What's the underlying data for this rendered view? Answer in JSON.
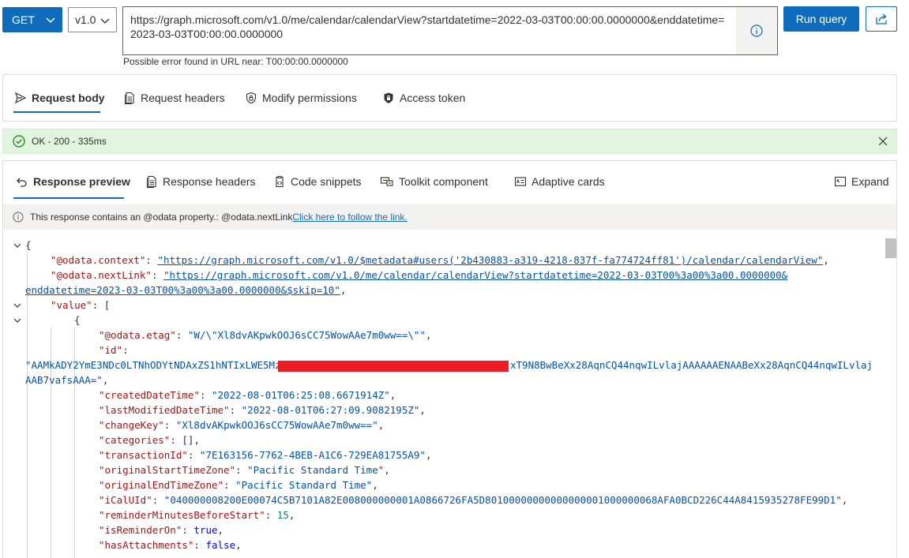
{
  "toolbar": {
    "method": "GET",
    "version": "v1.0",
    "url": "https://graph.microsoft.com/v1.0/me/calendar/calendarView?startdatetime=2022-03-03T00:00:00.0000000&enddatetime=2023-03-03T00:00:00.0000000",
    "url_error": "Possible error found in URL near: T00:00:00.0000000",
    "run_label": "Run query"
  },
  "request_tabs": [
    {
      "label": "Request body",
      "icon": "send-icon"
    },
    {
      "label": "Request headers",
      "icon": "document-icon"
    },
    {
      "label": "Modify permissions",
      "icon": "shield-lock-icon"
    },
    {
      "label": "Access token",
      "icon": "lock-icon"
    }
  ],
  "status": {
    "text": "OK - 200 - 335ms",
    "color": "#dff6dd"
  },
  "response_tabs": [
    {
      "label": "Response preview",
      "icon": "undo-arrow-icon"
    },
    {
      "label": "Response headers",
      "icon": "document-icon"
    },
    {
      "label": "Code snippets",
      "icon": "clipboard-code-icon"
    },
    {
      "label": "Toolkit component",
      "icon": "component-icon"
    },
    {
      "label": "Adaptive cards",
      "icon": "card-icon"
    }
  ],
  "expand_label": "Expand",
  "info": {
    "text": "This response contains an @odata property.: @odata.nextLink",
    "link": " Click here to follow the link."
  },
  "json": {
    "odata_context_key": "\"@odata.context\"",
    "odata_context_val": "\"https://graph.microsoft.com/v1.0/$metadata#users('2b430883-a319-4218-837f-fa774724ff81')/calendar/calendarView\"",
    "odata_next_key": "\"@odata.nextLink\"",
    "odata_next_val_1": "\"https://graph.microsoft.com/v1.0/me/calendar/calendarView?startdatetime=2022-03-03T00%3a00%3a00.0000000&",
    "odata_next_val_2": "enddatetime=2023-03-03T00%3a00%3a00.0000000&$skip=10\"",
    "value_key": "\"value\"",
    "etag_key": "\"@odata.etag\"",
    "etag_val": "\"W/\\\"Xl8dvAKpwkOOJ6sCC75WowAAe7m0ww==\\\"\"",
    "id_key": "\"id\"",
    "id_val_start": "\"AAMkADY2YmE3NDc0LTNhODYtNDAxZS1hNTIxLWE5MzYz",
    "id_val_end": "xT9N8BwBeXx28AqnCQ44nqwILvlajAAAAAAENAABeXx28AqnCQ44nqwILvlaj",
    "id_val_2": "AAB7vafsAAA=\"",
    "fields": [
      {
        "key": "\"createdDateTime\"",
        "val": "\"2022-08-01T06:25:08.6671914Z\"",
        "type": "s"
      },
      {
        "key": "\"lastModifiedDateTime\"",
        "val": "\"2022-08-01T06:27:09.9082195Z\"",
        "type": "s"
      },
      {
        "key": "\"changeKey\"",
        "val": "\"Xl8dvAKpwkOOJ6sCC75WowAAe7m0ww==\"",
        "type": "s"
      },
      {
        "key": "\"categories\"",
        "val": "[]",
        "type": "p"
      },
      {
        "key": "\"transactionId\"",
        "val": "\"7E163156-7762-4BEB-A1C6-729EA81755A9\"",
        "type": "s"
      },
      {
        "key": "\"originalStartTimeZone\"",
        "val": "\"Pacific Standard Time\"",
        "type": "s"
      },
      {
        "key": "\"originalEndTimeZone\"",
        "val": "\"Pacific Standard Time\"",
        "type": "s"
      },
      {
        "key": "\"iCalUId\"",
        "val": "\"040000008200E00074C5B7101A82E008000000001A0866726FA5D80100000000000000001000000068AFA0BCD226C44A8415935278FE99D1\"",
        "type": "s"
      },
      {
        "key": "\"reminderMinutesBeforeStart\"",
        "val": "15",
        "type": "n"
      },
      {
        "key": "\"isReminderOn\"",
        "val": "true",
        "type": "b"
      },
      {
        "key": "\"hasAttachments\"",
        "val": "false",
        "type": "b"
      }
    ]
  }
}
